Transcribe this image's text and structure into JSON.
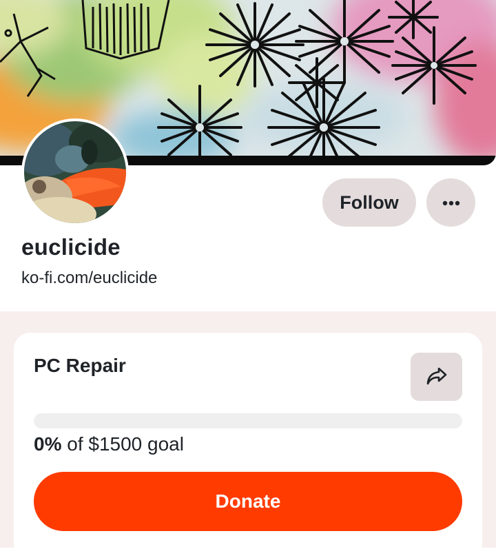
{
  "profile": {
    "username": "euclicide",
    "url": "ko-fi.com/euclicide",
    "follow_label": "Follow",
    "more_icon": "ellipsis-icon"
  },
  "goal": {
    "title": "PC Repair",
    "share_icon": "share-arrow-icon",
    "progress_percent": 0,
    "percent_label": "0%",
    "goal_suffix": "of $1500 goal",
    "donate_label": "Donate"
  },
  "colors": {
    "accent": "#ff3b00",
    "button_bg": "#e4dcdc",
    "section_bg": "#f7efed",
    "text": "#1f2328"
  }
}
